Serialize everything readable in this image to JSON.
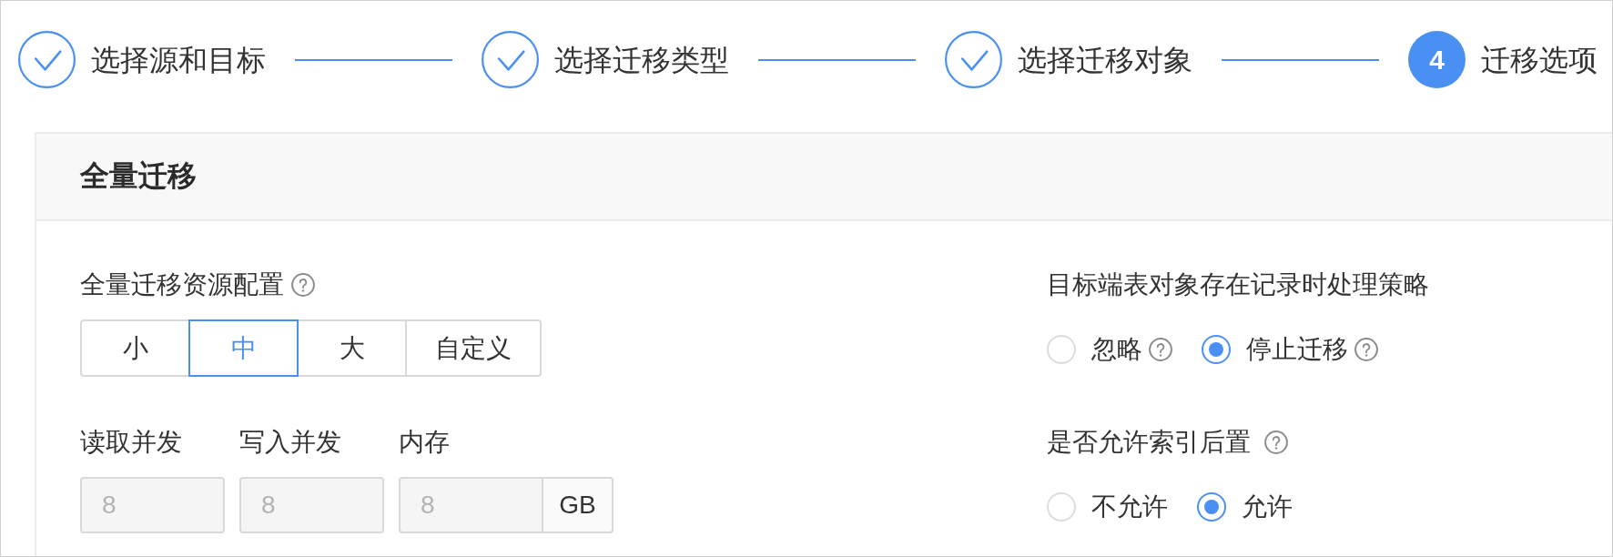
{
  "steps": [
    {
      "label": "选择源和目标",
      "done": true
    },
    {
      "label": "选择迁移类型",
      "done": true
    },
    {
      "label": "选择迁移对象",
      "done": true
    },
    {
      "number": "4",
      "label": "迁移选项",
      "done": false
    }
  ],
  "section": {
    "title": "全量迁移",
    "resource_config": {
      "label": "全量迁移资源配置",
      "help": true,
      "options": [
        {
          "label": "小",
          "selected": false
        },
        {
          "label": "中",
          "selected": true
        },
        {
          "label": "大",
          "selected": false
        },
        {
          "label": "自定义",
          "selected": false
        }
      ]
    },
    "fields": [
      {
        "label": "读取并发",
        "value": "8",
        "disabled": true
      },
      {
        "label": "写入并发",
        "value": "8",
        "disabled": true
      },
      {
        "label": "内存",
        "value": "8",
        "disabled": true,
        "unit": "GB"
      }
    ],
    "conflict_policy": {
      "label": "目标端表对象存在记录时处理策略",
      "help": false,
      "options": [
        {
          "label": "忽略",
          "help": true,
          "selected": false
        },
        {
          "label": "停止迁移",
          "help": true,
          "selected": true
        }
      ]
    },
    "index_postpone": {
      "label": "是否允许索引后置",
      "help": true,
      "options": [
        {
          "label": "不允许",
          "help": false,
          "selected": false
        },
        {
          "label": "允许",
          "help": false,
          "selected": true
        }
      ]
    }
  }
}
